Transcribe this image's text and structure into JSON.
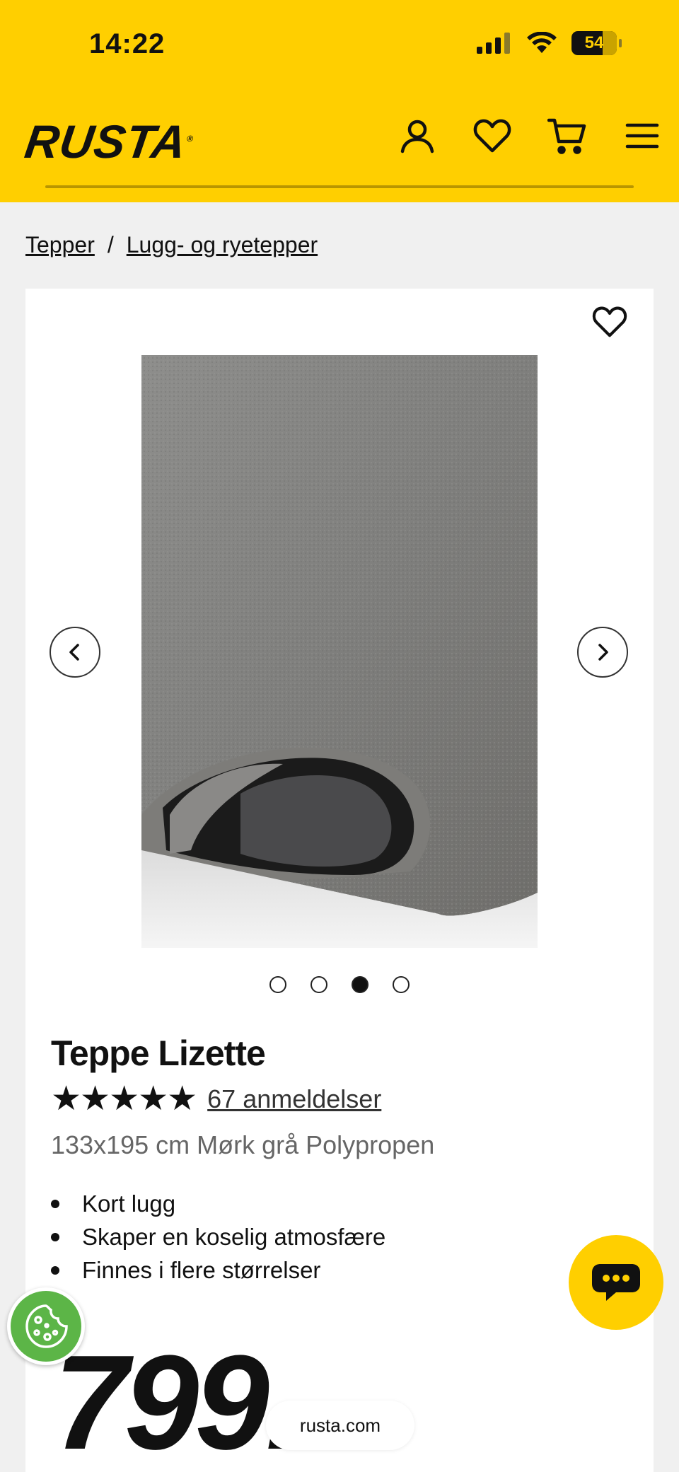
{
  "status_bar": {
    "time": "14:22",
    "battery": "54"
  },
  "header": {
    "logo": "RUSTA",
    "icons": [
      "account-icon",
      "heart-icon",
      "cart-icon",
      "menu-icon"
    ],
    "brand_color": "#ffcf00"
  },
  "breadcrumb": {
    "items": [
      "Tepper",
      "Lugg- og ryetepper"
    ],
    "separator": "/"
  },
  "product": {
    "name": "Teppe Lizette",
    "stars": "★★★★★",
    "rating_value": 5,
    "reviews": "67 anmeldelser",
    "variant": "133x195 cm Mørk grå Polypropen",
    "features": [
      "Kort lugg",
      "Skaper en koselig atmosfære",
      "Finnes i flere størrelser"
    ],
    "price": "799.-",
    "image_count": 4,
    "active_image": 3
  },
  "browser": {
    "url": "rusta.com"
  }
}
